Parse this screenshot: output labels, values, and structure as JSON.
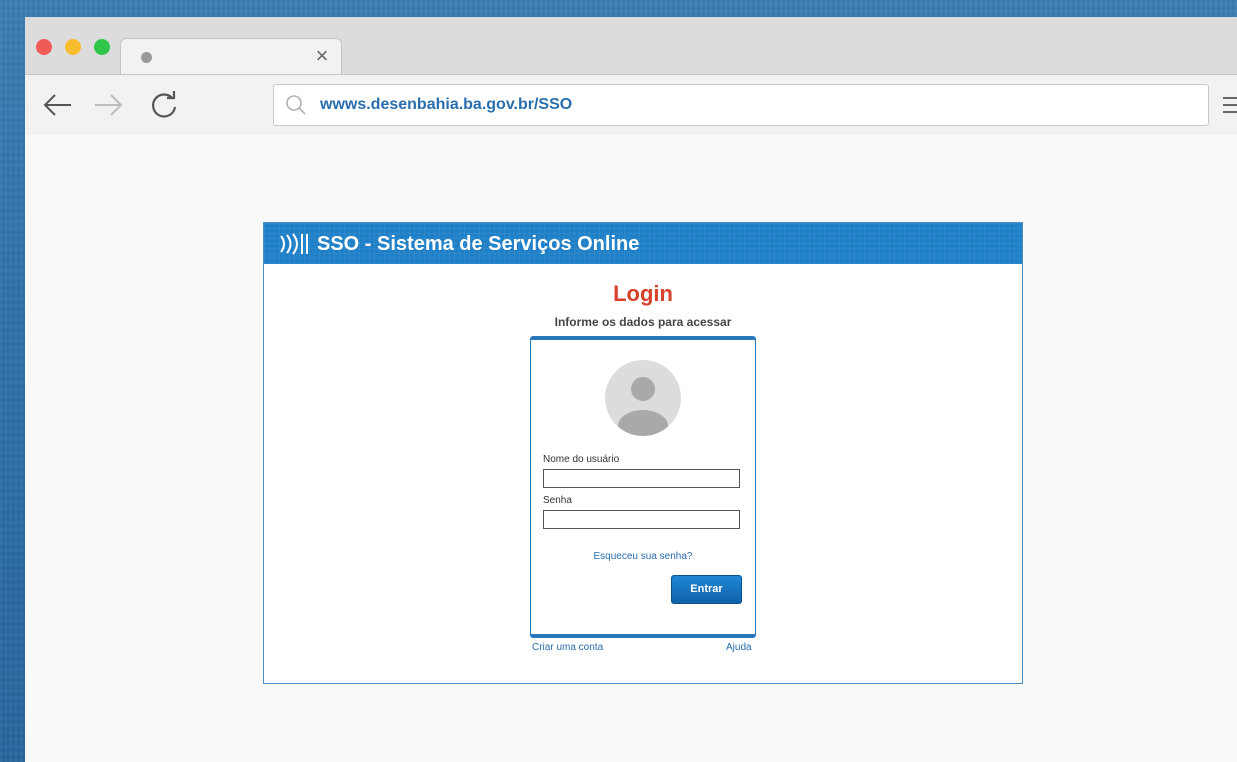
{
  "browser": {
    "tab_close_glyph": "×",
    "url": "wwws.desenbahia.ba.gov.br/SSO"
  },
  "panel": {
    "title": "SSO - Sistema de Serviços Online"
  },
  "login": {
    "title": "Login",
    "subtitle": "Informe os dados para acessar",
    "username_label": "Nome do usuário",
    "username_value": "",
    "password_label": "Senha",
    "password_value": "",
    "forgot_link": "Esqueceu sua senha?",
    "submit_label": "Entrar",
    "create_account_link": "Criar uma conta",
    "help_link": "Ajuda"
  },
  "colors": {
    "header_blue": "#1f7fc7",
    "login_title_red": "#d6412c",
    "link_blue": "#2a6eae",
    "button_blue": "#1276c2"
  },
  "icons": [
    "back-arrow-icon",
    "forward-arrow-icon",
    "reload-icon",
    "search-icon",
    "menu-icon",
    "sso-logo-icon",
    "user-avatar-icon"
  ]
}
